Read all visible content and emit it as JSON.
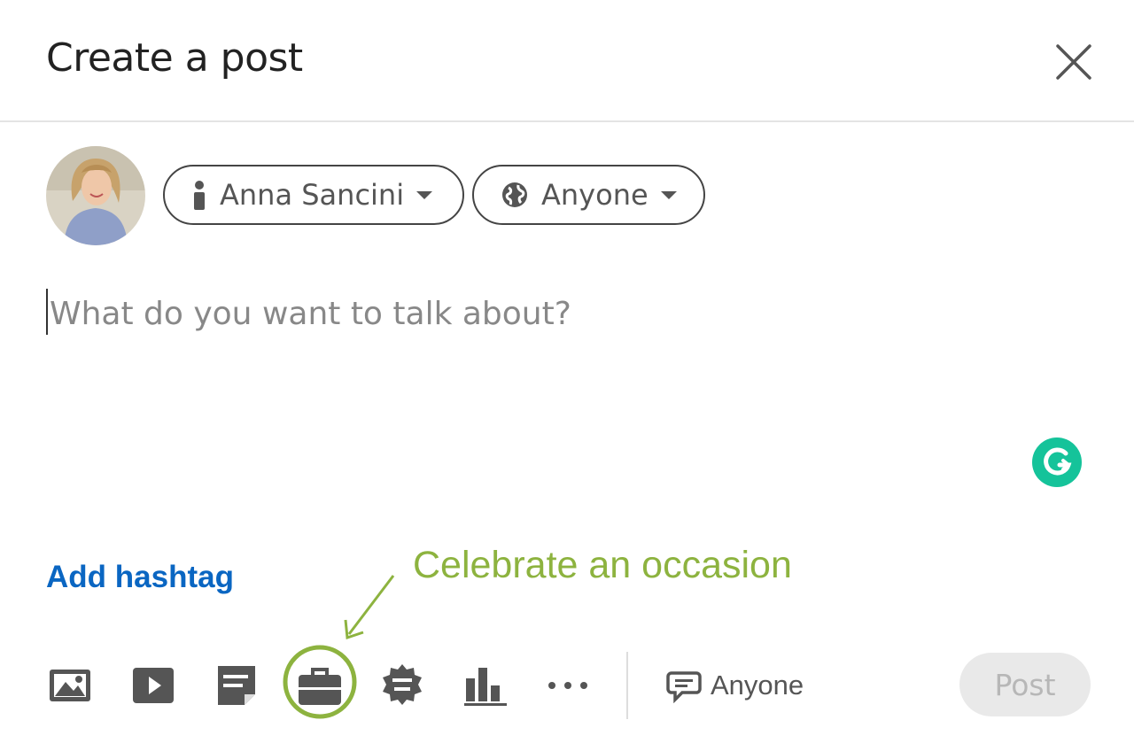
{
  "dialog": {
    "title": "Create a post"
  },
  "author": {
    "name": "Anna Sancini"
  },
  "visibility": {
    "label": "Anyone"
  },
  "editor": {
    "placeholder": "What do you want to talk about?"
  },
  "add_hashtag_label": "Add hashtag",
  "annotation": {
    "text": "Celebrate an occasion",
    "color": "#8db33f"
  },
  "toolbar": {
    "tools": [
      {
        "icon": "photo-icon"
      },
      {
        "icon": "video-icon"
      },
      {
        "icon": "document-icon"
      },
      {
        "icon": "briefcase-icon"
      },
      {
        "icon": "badge-icon"
      },
      {
        "icon": "poll-icon"
      },
      {
        "icon": "more-icon"
      }
    ],
    "comment_control_label": "Anyone",
    "post_label": "Post"
  },
  "colors": {
    "link_blue": "#0a66c2",
    "grammarly_green": "#15c39a",
    "icon_gray": "#555555",
    "post_disabled_bg": "#e9e9e9"
  }
}
